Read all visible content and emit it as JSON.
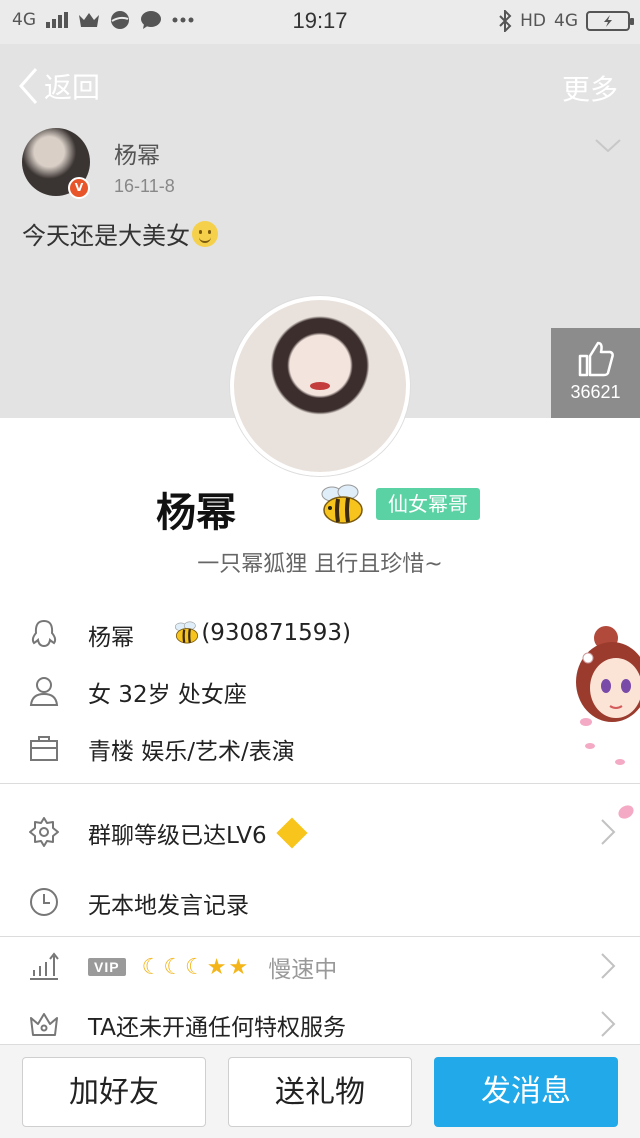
{
  "status_bar": {
    "network_left": "4G",
    "time": "19:17",
    "hd": "HD",
    "network_right": "4G"
  },
  "nav": {
    "back_label": "返回",
    "more_label": "更多"
  },
  "post": {
    "author": "杨幂",
    "date": "16-11-8",
    "text": "今天还是大美女",
    "badge": "V"
  },
  "like": {
    "count": "36621"
  },
  "profile": {
    "name": "杨幂",
    "tag": "仙女幂哥",
    "signature": "一只幂狐狸 且行且珍惜~"
  },
  "info": {
    "qq_name": "杨幂",
    "qq_number": "(930871593)",
    "sex_age_star": "女  32岁  处女座",
    "job": "青楼 娱乐/艺术/表演"
  },
  "list": {
    "group_level": "群聊等级已达LV6",
    "history": "无本地发言记录",
    "vip_tag": "VIP",
    "vip_status": "慢速中",
    "privilege": "TA还未开通任何特权服务"
  },
  "buttons": {
    "add_friend": "加好友",
    "send_gift": "送礼物",
    "send_message": "发消息"
  },
  "colors": {
    "tag_green": "#5bd2a4",
    "primary_blue": "#21a9e9",
    "moon_gold": "#f3b51a"
  }
}
